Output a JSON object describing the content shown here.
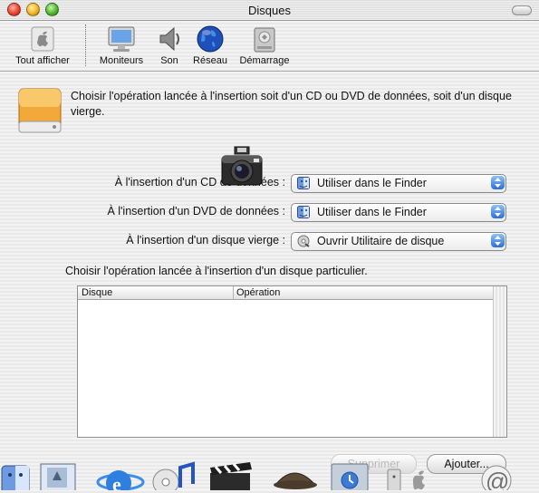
{
  "window": {
    "title": "Disques"
  },
  "toolbar": {
    "items": [
      {
        "label": "Tout afficher",
        "icon": "apple-icon"
      },
      {
        "label": "Moniteurs",
        "icon": "monitor-icon"
      },
      {
        "label": "Son",
        "icon": "speaker-icon"
      },
      {
        "label": "Réseau",
        "icon": "globe-icon"
      },
      {
        "label": "Démarrage",
        "icon": "hard-disk-icon"
      }
    ]
  },
  "intro": "Choisir l'opération lancée à l'insertion soit d'un CD ou DVD de données, soit d'un disque vierge.",
  "rows": [
    {
      "label": "À l'insertion d'un CD de données :",
      "value": "Utiliser dans le Finder",
      "icon": "finder-icon"
    },
    {
      "label": "À l'insertion d'un DVD de données :",
      "value": "Utiliser dans le Finder",
      "icon": "finder-icon"
    },
    {
      "label": "À l'insertion d'un disque vierge :",
      "value": "Ouvrir Utilitaire de disque",
      "icon": "disk-utility-icon"
    }
  ],
  "particular": "Choisir l'opération lancée à l'insertion d'un disque particulier.",
  "table": {
    "columns": [
      "Disque",
      "Opération"
    ],
    "rows": []
  },
  "buttons": {
    "remove": "Supprimer",
    "add": "Ajouter..."
  },
  "dock": [
    "finder-icon",
    "mail-icon",
    "internet-explorer-icon",
    "itunes-icon",
    "imovie-icon",
    "sherlock-icon",
    "system-preferences-icon",
    "apple-icon",
    "mail-at-icon"
  ],
  "colors": {
    "accent": "#3a7ad8",
    "disabled_text": "#b8b8b8"
  }
}
